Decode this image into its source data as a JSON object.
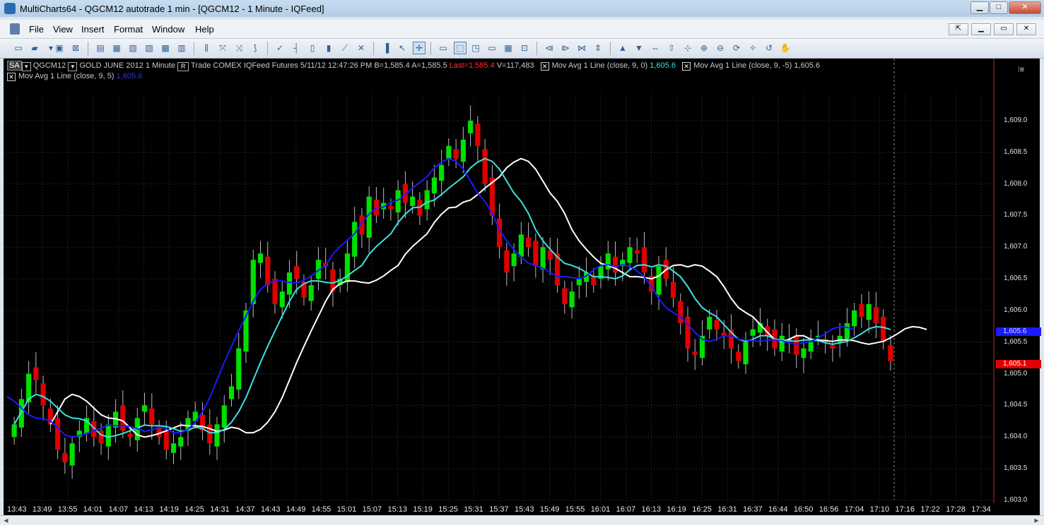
{
  "window": {
    "title": "MultiCharts64 - QGCM12 autotrade 1 min - [QGCM12 - 1 Minute - IQFeed]",
    "controls": [
      "▁",
      "□",
      "✕"
    ]
  },
  "menu": {
    "items": [
      "File",
      "View",
      "Insert",
      "Format",
      "Window",
      "Help"
    ],
    "mdi_controls": [
      "⇱",
      "▁",
      "▭",
      "✕"
    ]
  },
  "toolbar": {
    "icons": [
      "new-chart-icon",
      "open-folder-icon",
      "dropdown-icon",
      "save-icon",
      "close-doc-icon",
      "format-icon",
      "format-symbol-icon",
      "format-window-icon",
      "format-study-icon",
      "format-signal-icon",
      "format-drawings-icon",
      "insert-study-icon",
      "insert-signal-icon",
      "insert-strategy-icon",
      "insert-indicator-icon",
      "check-icon",
      "ohlc-bar-icon",
      "candle-icon",
      "hollow-candle-icon",
      "line-icon",
      "point-figure-icon",
      "volume-icon",
      "pointer-icon",
      "crosshair-icon",
      "text-icon",
      "trendline-icon",
      "channel-icon",
      "window-icon",
      "data-window-icon",
      "zoom-window-icon",
      "scroll-left-icon",
      "scroll-right-icon",
      "center-icon",
      "expand-icon",
      "up-icon",
      "down-icon",
      "left-right-icon",
      "fit-icon",
      "move-icon",
      "zoom-in-icon",
      "zoom-out-icon",
      "refresh-icon",
      "magic-icon",
      "replay-icon",
      "hand-icon"
    ]
  },
  "chart_header": {
    "sa_label": "SA",
    "symbol": "QGCM12",
    "description": "GOLD JUNE 2012",
    "interval": "1 Minute",
    "r_label": "R",
    "category": "Trade",
    "exchange": "COMEX",
    "feed": "IQFeed",
    "type": "Futures",
    "date": "5/11/12",
    "time": "12:47:26 PM",
    "bid": "B=1,585.4",
    "ask": "A=1,585.5",
    "last": "Last=1,585.4",
    "volume": "V=117,483",
    "study1_label": "Mov Avg 1 Line",
    "study1_params": "(close, 9, 0)",
    "study1_value": "1,605.6",
    "study2_label": "Mov Avg 1 Line",
    "study2_params": "(close, 9, -5)",
    "study2_value": "1,605.6",
    "study3_label": "Mov Avg 1 Line",
    "study3_params": "(close, 9, 5)",
    "study3_value": "1,605.6"
  },
  "price_flags": {
    "blue": "1,605.6",
    "red": "1,605.1"
  },
  "colors": {
    "up": "#00e000",
    "down": "#e00000",
    "ma_offset0": "#40e0e0",
    "ma_offset_neg5": "#ffffff",
    "ma_offset_pos5": "#1a1aff",
    "grid": "#3a3a3a",
    "last_red": "#ff3030"
  },
  "chart_data": {
    "type": "candlestick",
    "title": "QGCM12 - 1 Minute",
    "ylim": [
      1603.0,
      1609.2
    ],
    "y_ticks": [
      "1,603.0",
      "1,603.5",
      "1,604.0",
      "1,604.5",
      "1,605.0",
      "1,605.5",
      "1,606.0",
      "1,606.5",
      "1,607.0",
      "1,607.5",
      "1,608.0",
      "1,608.5",
      "1,609.0"
    ],
    "x_ticks": [
      "13:43",
      "13:49",
      "13:55",
      "14:01",
      "14:07",
      "14:13",
      "14:19",
      "14:25",
      "14:31",
      "14:37",
      "14:43",
      "14:49",
      "14:55",
      "15:01",
      "15:07",
      "15:13",
      "15:19",
      "15:25",
      "15:31",
      "15:37",
      "15:43",
      "15:49",
      "15:55",
      "16:01",
      "16:07",
      "16:13",
      "16:19",
      "16:25",
      "16:31",
      "16:37",
      "16:44",
      "16:50",
      "16:56",
      "17:04",
      "17:10",
      "17:16",
      "17:22",
      "17:28",
      "17:34"
    ],
    "closes": [
      1604.2,
      1604.6,
      1605.0,
      1604.9,
      1604.5,
      1604.2,
      1603.8,
      1603.6,
      1603.9,
      1604.1,
      1604.3,
      1604.0,
      1603.9,
      1604.2,
      1604.4,
      1604.1,
      1604.0,
      1604.3,
      1604.5,
      1604.2,
      1604.0,
      1603.8,
      1603.9,
      1604.0,
      1604.3,
      1604.4,
      1604.1,
      1603.9,
      1604.2,
      1604.5,
      1604.8,
      1605.4,
      1606.0,
      1606.8,
      1606.9,
      1606.4,
      1606.1,
      1606.3,
      1606.6,
      1606.5,
      1606.2,
      1606.4,
      1606.8,
      1606.7,
      1606.3,
      1606.5,
      1606.9,
      1607.4,
      1607.2,
      1607.8,
      1607.5,
      1607.7,
      1607.6,
      1607.9,
      1607.7,
      1607.8,
      1607.5,
      1607.9,
      1608.1,
      1608.3,
      1608.6,
      1608.4,
      1608.7,
      1609.0,
      1608.6,
      1608.0,
      1607.5,
      1607.0,
      1606.6,
      1606.9,
      1607.2,
      1607.0,
      1606.7,
      1607.0,
      1606.8,
      1606.4,
      1606.1,
      1606.3,
      1606.5,
      1606.6,
      1606.4,
      1606.7,
      1606.9,
      1606.6,
      1606.8,
      1607.0,
      1606.9,
      1606.6,
      1606.3,
      1606.7,
      1606.5,
      1606.2,
      1605.8,
      1605.4,
      1605.3,
      1605.6,
      1605.9,
      1605.7,
      1605.6,
      1605.4,
      1605.2,
      1605.5,
      1605.7,
      1605.8,
      1605.6,
      1605.4,
      1605.6,
      1605.5,
      1605.3,
      1605.4,
      1605.5,
      1605.6,
      1605.5,
      1605.4,
      1605.6,
      1605.8,
      1606.0,
      1605.9,
      1606.1,
      1605.8,
      1605.5,
      1605.2
    ]
  }
}
